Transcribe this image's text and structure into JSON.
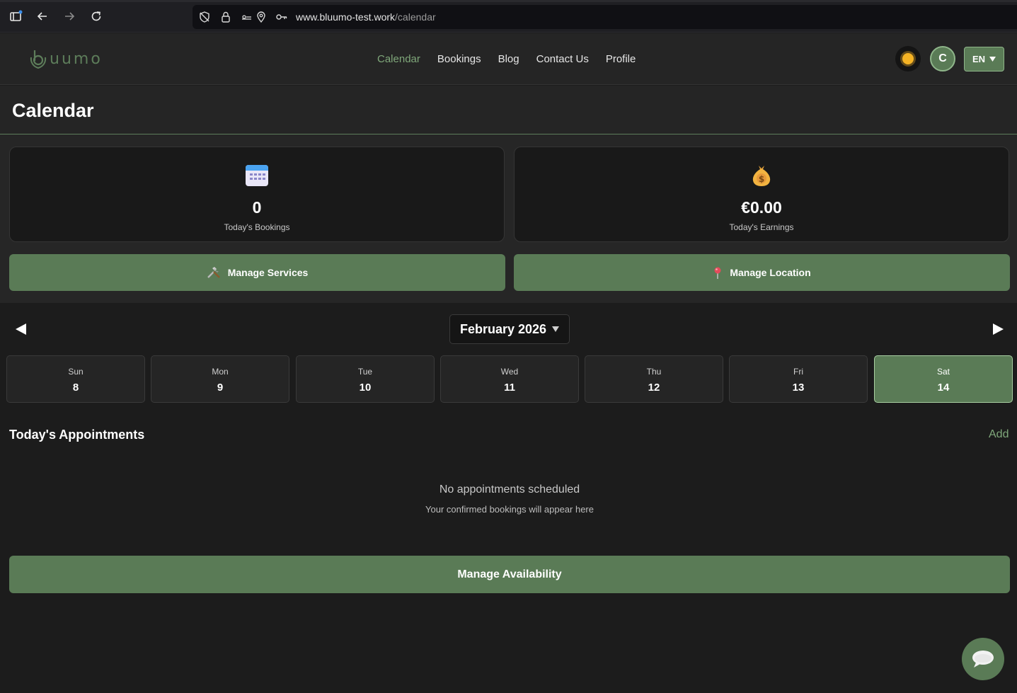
{
  "browser": {
    "url_host": "www.bluumo-test.work",
    "url_path": "/calendar"
  },
  "app": {
    "logo_text": "uumo",
    "nav": [
      {
        "label": "Calendar",
        "active": true
      },
      {
        "label": "Bookings",
        "active": false
      },
      {
        "label": "Blog",
        "active": false
      },
      {
        "label": "Contact Us",
        "active": false
      },
      {
        "label": "Profile",
        "active": false
      }
    ],
    "avatar_initial": "C",
    "language": "EN"
  },
  "page": {
    "title": "Calendar"
  },
  "stats": {
    "bookings_value": "0",
    "bookings_label": "Today's Bookings",
    "earnings_value": "€0.00",
    "earnings_label": "Today's Earnings"
  },
  "actions": {
    "manage_services": "Manage Services",
    "manage_location": "Manage Location"
  },
  "calendar": {
    "month": "February 2026",
    "days": [
      {
        "name": "Sun",
        "date": "8",
        "selected": false
      },
      {
        "name": "Mon",
        "date": "9",
        "selected": false
      },
      {
        "name": "Tue",
        "date": "10",
        "selected": false
      },
      {
        "name": "Wed",
        "date": "11",
        "selected": false
      },
      {
        "name": "Thu",
        "date": "12",
        "selected": false
      },
      {
        "name": "Fri",
        "date": "13",
        "selected": false
      },
      {
        "name": "Sat",
        "date": "14",
        "selected": true
      }
    ]
  },
  "appointments": {
    "title": "Today's Appointments",
    "add_label": "Add",
    "empty_title": "No appointments scheduled",
    "empty_subtitle": "Your confirmed bookings will appear here"
  },
  "availability": {
    "button_label": "Manage Availability"
  },
  "colors": {
    "accent": "#5a7b56",
    "accent_light": "#7fa77a",
    "background": "#1c1c1c"
  }
}
